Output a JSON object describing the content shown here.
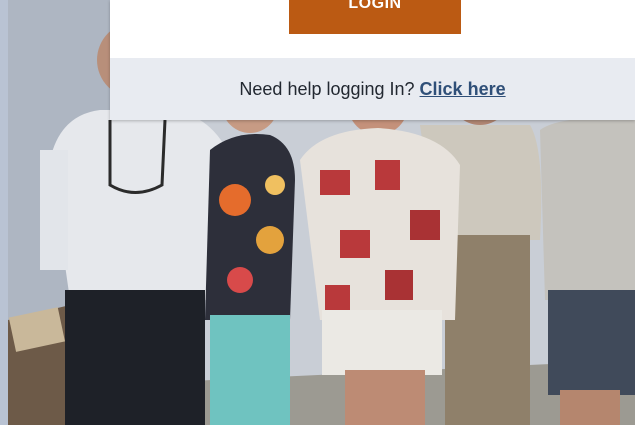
{
  "login": {
    "button_label": "LOGIN",
    "accent_color": "#bb5a13"
  },
  "help": {
    "prompt": "Need help logging In?",
    "link_label": "Click here",
    "link_color": "#2f4f78"
  },
  "background": {
    "image_subject": "group-photo"
  }
}
